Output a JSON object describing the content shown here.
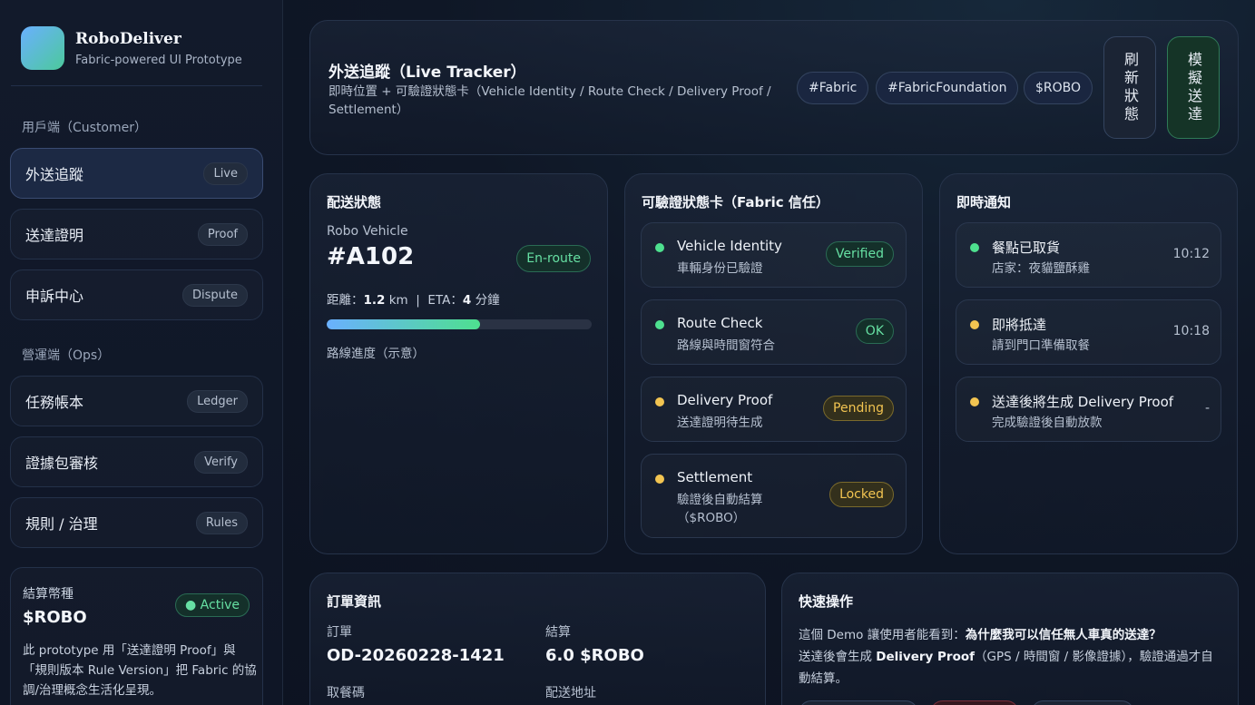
{
  "brand": {
    "name": "RoboDeliver",
    "subtitle": "Fabric-powered UI Prototype"
  },
  "sidebar": {
    "customer_label": "用戶端（Customer）",
    "ops_label": "營運端（Ops）",
    "customer_items": [
      {
        "label": "外送追蹤",
        "badge": "Live"
      },
      {
        "label": "送達證明",
        "badge": "Proof"
      },
      {
        "label": "申訴中心",
        "badge": "Dispute"
      }
    ],
    "ops_items": [
      {
        "label": "任務帳本",
        "badge": "Ledger"
      },
      {
        "label": "證據包審核",
        "badge": "Verify"
      },
      {
        "label": "規則 / 治理",
        "badge": "Rules"
      }
    ],
    "token": {
      "label": "結算幣種",
      "value": "$ROBO",
      "status": "● Active",
      "description": "此 prototype 用「送達證明 Proof」與「規則版本 Rule Version」把 Fabric 的協調/治理概念生活化呈現。"
    }
  },
  "header": {
    "title": "外送追蹤（Live Tracker）",
    "subtitle": "即時位置 + 可驗證狀態卡（Vehicle Identity / Route Check / Delivery Proof / Settlement）",
    "tags": [
      "#Fabric",
      "#FabricFoundation",
      "$ROBO"
    ],
    "refresh_button": "刷新狀態",
    "simulate_button": "模擬送達"
  },
  "status_card": {
    "title": "配送狀態",
    "vehicle_label": "Robo Vehicle",
    "vehicle_id": "#A102",
    "state": "En-route",
    "distance_label": "距離：",
    "distance_value": "1.2",
    "distance_unit": " km",
    "separator": "  |  ",
    "eta_label": "ETA：",
    "eta_value": "4",
    "eta_unit": " 分鐘",
    "progress": 0.58,
    "progress_label": "路線進度（示意）"
  },
  "verify_card": {
    "title": "可驗證狀態卡（Fabric 信任）",
    "rows": [
      {
        "title": "Vehicle Identity",
        "sub": "車輛身份已驗證",
        "badge": "Verified"
      },
      {
        "title": "Route Check",
        "sub": "路線與時間窗符合",
        "badge": "OK"
      },
      {
        "title": "Delivery Proof",
        "sub": "送達證明待生成",
        "badge": "Pending"
      },
      {
        "title": "Settlement",
        "sub": "驗證後自動結算（$ROBO）",
        "badge": "Locked"
      }
    ]
  },
  "notify_card": {
    "title": "即時通知",
    "rows": [
      {
        "title": "餐點已取貨",
        "sub": "店家：夜貓鹽酥雞",
        "time": "10:12"
      },
      {
        "title": "即將抵達",
        "sub": "請到門口準備取餐",
        "time": "10:18"
      },
      {
        "title": "送達後將生成 Delivery Proof",
        "sub": "完成驗證後自動放款",
        "time": "-"
      }
    ]
  },
  "order_card": {
    "title": "訂單資訊",
    "order_label": "訂單",
    "order_value": "OD-20260228-1421",
    "settle_label": "結算",
    "settle_value": "6.0 $ROBO",
    "pickup_label": "取餐碼",
    "address_label": "配送地址"
  },
  "quick_card": {
    "title": "快速操作",
    "line1_prefix": "這個 Demo 讓使用者能看到：",
    "line1_bold": "為什麼我可以信任無人車真的送達？",
    "line2_prefix": "送達後會生成 ",
    "line2_bold": "Delivery Proof",
    "line2_suffix": "（GPS / 時間窗 / 影像證據），驗證通過才自動結算。"
  }
}
